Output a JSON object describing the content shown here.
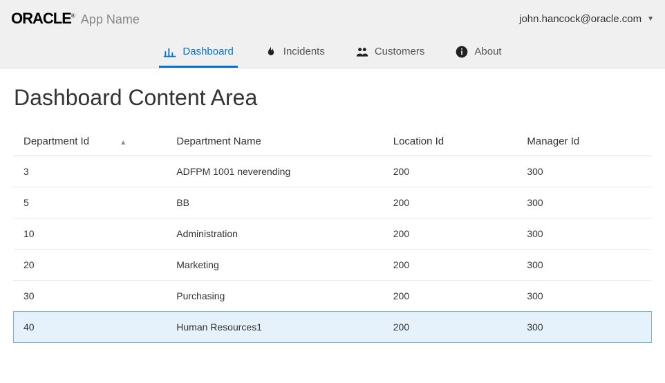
{
  "header": {
    "brand": "ORACLE",
    "app_name": "App Name",
    "user": "john.hancock@oracle.com"
  },
  "nav": {
    "tabs": [
      {
        "label": "Dashboard",
        "icon": "bar-chart-icon",
        "active": true
      },
      {
        "label": "Incidents",
        "icon": "flame-icon",
        "active": false
      },
      {
        "label": "Customers",
        "icon": "people-icon",
        "active": false
      },
      {
        "label": "About",
        "icon": "info-icon",
        "active": false
      }
    ]
  },
  "page": {
    "title": "Dashboard Content Area"
  },
  "table": {
    "columns": [
      {
        "label": "Department Id",
        "sort": "asc"
      },
      {
        "label": "Department Name"
      },
      {
        "label": "Location Id"
      },
      {
        "label": "Manager Id"
      }
    ],
    "rows": [
      {
        "dept_id": "3",
        "dept_name": "ADFPM 1001 neverending",
        "loc_id": "200",
        "mgr_id": "300"
      },
      {
        "dept_id": "5",
        "dept_name": "BB",
        "loc_id": "200",
        "mgr_id": "300"
      },
      {
        "dept_id": "10",
        "dept_name": "Administration",
        "loc_id": "200",
        "mgr_id": "300"
      },
      {
        "dept_id": "20",
        "dept_name": "Marketing",
        "loc_id": "200",
        "mgr_id": "300"
      },
      {
        "dept_id": "30",
        "dept_name": "Purchasing",
        "loc_id": "200",
        "mgr_id": "300"
      },
      {
        "dept_id": "40",
        "dept_name": "Human Resources1",
        "loc_id": "200",
        "mgr_id": "300",
        "selected": true
      }
    ]
  }
}
